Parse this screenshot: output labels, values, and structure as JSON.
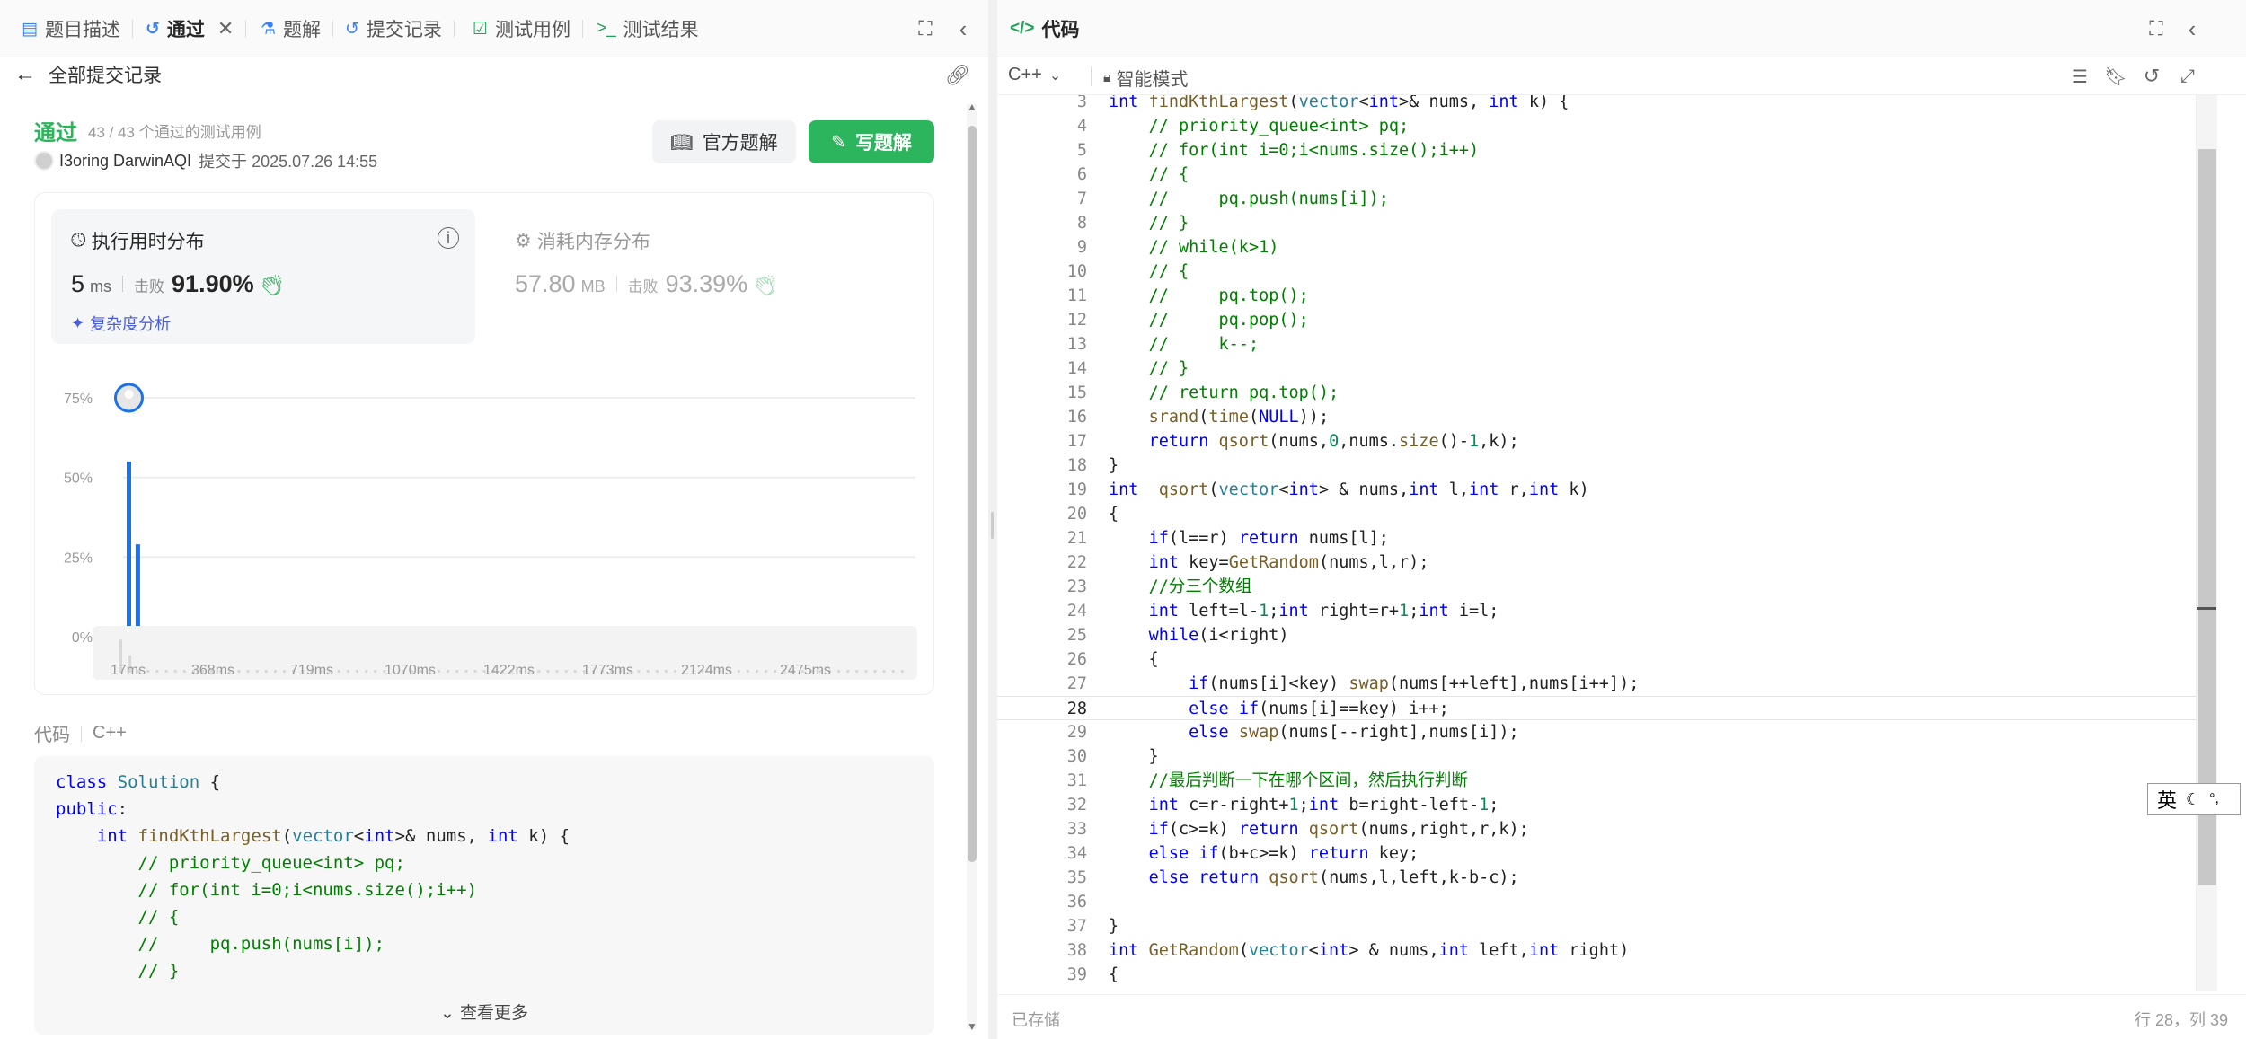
{
  "left": {
    "tabs": [
      {
        "label": "题目描述",
        "icon": "doc-icon"
      },
      {
        "label": "通过",
        "icon": "history-icon"
      },
      {
        "label": "题解",
        "icon": "flask-icon"
      },
      {
        "label": "提交记录",
        "icon": "history-icon"
      },
      {
        "label": "测试用例",
        "icon": "checkbox-icon"
      },
      {
        "label": "测试结果",
        "icon": "terminal-icon"
      }
    ],
    "back_label": "全部提交记录",
    "status": "通过",
    "passed_cases": "43 / 43 个通过的测试用例",
    "user": "I3oring DarwinAQI",
    "submitted_at": "提交于 2025.07.26 14:55",
    "official_solution_btn": "官方题解",
    "write_solution_btn": "写题解",
    "runtime": {
      "title": "执行用时分布",
      "value": "5",
      "unit": "ms",
      "beats_label": "击败",
      "beats": "91.90%",
      "complexity_link": "复杂度分析"
    },
    "memory": {
      "title": "消耗内存分布",
      "value": "57.80",
      "unit": "MB",
      "beats_label": "击败",
      "beats": "93.39%"
    },
    "code_section_label": "代码",
    "code_language": "C++",
    "code_preview": [
      "class Solution {",
      "public:",
      "    int findKthLargest(vector<int>& nums, int k) {",
      "        // priority_queue<int> pq;",
      "        // for(int i=0;i<nums.size();i++)",
      "        // {",
      "        //     pq.push(nums[i]);",
      "        // }"
    ],
    "see_more": "查看更多"
  },
  "chart_data": {
    "type": "bar",
    "y_ticks": [
      "75%",
      "50%",
      "25%",
      "0%"
    ],
    "ylim": [
      0,
      75
    ],
    "x_ticks": [
      "17ms",
      "368ms",
      "719ms",
      "1070ms",
      "1422ms",
      "1773ms",
      "2124ms",
      "2475ms"
    ],
    "values": [
      55,
      29,
      1.5,
      1.5,
      1.5,
      1.5,
      1.5,
      1.5,
      1.5,
      1.5,
      1.5,
      1.5,
      1.5,
      1.5,
      1.5,
      1.5,
      1.5,
      1.5,
      1.5,
      1.5,
      1.5,
      1.5,
      1.5,
      1.5,
      1.5,
      1.5,
      1.5,
      1.5,
      1.5,
      1.5,
      1.5,
      1.5,
      1.5,
      1.5,
      1.5,
      1.5,
      1.5,
      1.5,
      1.5,
      1.5,
      1.5,
      1.5,
      1.5,
      1.5,
      1.5,
      1.5,
      1.5,
      1.5,
      1.5,
      1.5,
      1.5,
      1.5,
      1.5,
      1.5,
      1.5,
      1.5,
      1.5,
      1.5,
      1.5,
      1.5,
      1.5,
      1.5,
      1.5,
      1.5,
      1.5,
      1.5,
      1.5,
      1.5,
      1.5,
      1.5,
      1.5,
      1.5,
      1.5,
      1.5,
      1.5,
      1.5,
      1.5,
      1.5,
      1.5,
      1.5,
      1.5,
      1.5,
      1.5,
      1.5,
      1.5,
      1.5,
      1.5
    ],
    "highlight_index": 0,
    "bar_color": "#1a73e8",
    "grid": true
  },
  "right": {
    "title": "代码",
    "language": "C++",
    "mode": "智能模式",
    "saved": "已存储",
    "cursor": "行 28，列 39",
    "ime": "英",
    "start_line": 3,
    "highlight_line": 28,
    "lines": [
      "int findKthLargest(vector<int>& nums, int k) {",
      "    // priority_queue<int> pq;",
      "    // for(int i=0;i<nums.size();i++)",
      "    // {",
      "    //     pq.push(nums[i]);",
      "    // }",
      "    // while(k>1)",
      "    // {",
      "    //     pq.top();",
      "    //     pq.pop();",
      "    //     k--;",
      "    // }",
      "    // return pq.top();",
      "    srand(time(NULL));",
      "    return qsort(nums,0,nums.size()-1,k);",
      "}",
      "int  qsort(vector<int> & nums,int l,int r,int k)",
      "{",
      "    if(l==r) return nums[l];",
      "    int key=GetRandom(nums,l,r);",
      "    //分三个数组",
      "    int left=l-1;int right=r+1;int i=l;",
      "    while(i<right)",
      "    {",
      "        if(nums[i]<key) swap(nums[++left],nums[i++]);",
      "        else if(nums[i]==key) i++;",
      "        else swap(nums[--right],nums[i]);",
      "    }",
      "    //最后判断一下在哪个区间，然后执行判断",
      "    int c=r-right+1;int b=right-left-1;",
      "    if(c>=k) return qsort(nums,right,r,k);",
      "    else if(b+c>=k) return key;",
      "    else return qsort(nums,l,left,k-b-c);",
      "",
      "}",
      "int GetRandom(vector<int> & nums,int left,int right)",
      "{"
    ]
  }
}
